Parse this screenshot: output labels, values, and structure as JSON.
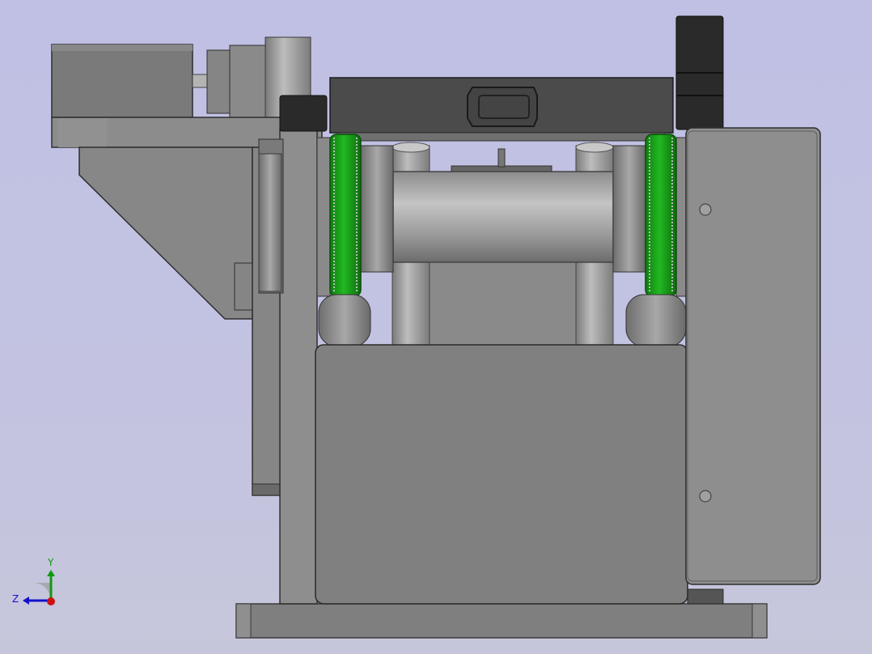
{
  "viewport": {
    "background_top": "#c0c0e4",
    "background_bottom": "#c6c6db"
  },
  "colors": {
    "body_gray": "#8a8a8a",
    "dark_gray": "#4a4a4a",
    "black_part": "#2a2a2a",
    "wheel_green": "#1aa21a",
    "wheel_green_dark": "#0d7a0d",
    "axis_x": "#cc1111",
    "axis_y": "#119911",
    "axis_z": "#1111cc"
  },
  "triad": {
    "y_label": "Y",
    "z_label": "Z"
  }
}
